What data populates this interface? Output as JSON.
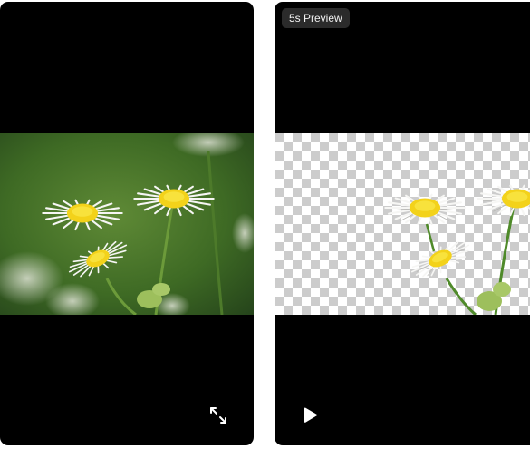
{
  "left_panel": {
    "image_description": "original",
    "expand_icon": "expand-arrows-icon"
  },
  "right_panel": {
    "badge_text": "5s Preview",
    "play_icon": "play-icon"
  },
  "colors": {
    "panel_bg": "#000000",
    "page_bg": "#ffffff",
    "badge_bg": "#2b2b2b",
    "checker_light": "#ffffff",
    "checker_dark": "#cccccc",
    "grass_green": "#4f7a2c",
    "petal_white": "#f6f6f4",
    "center_yellow": "#f3d21a"
  }
}
